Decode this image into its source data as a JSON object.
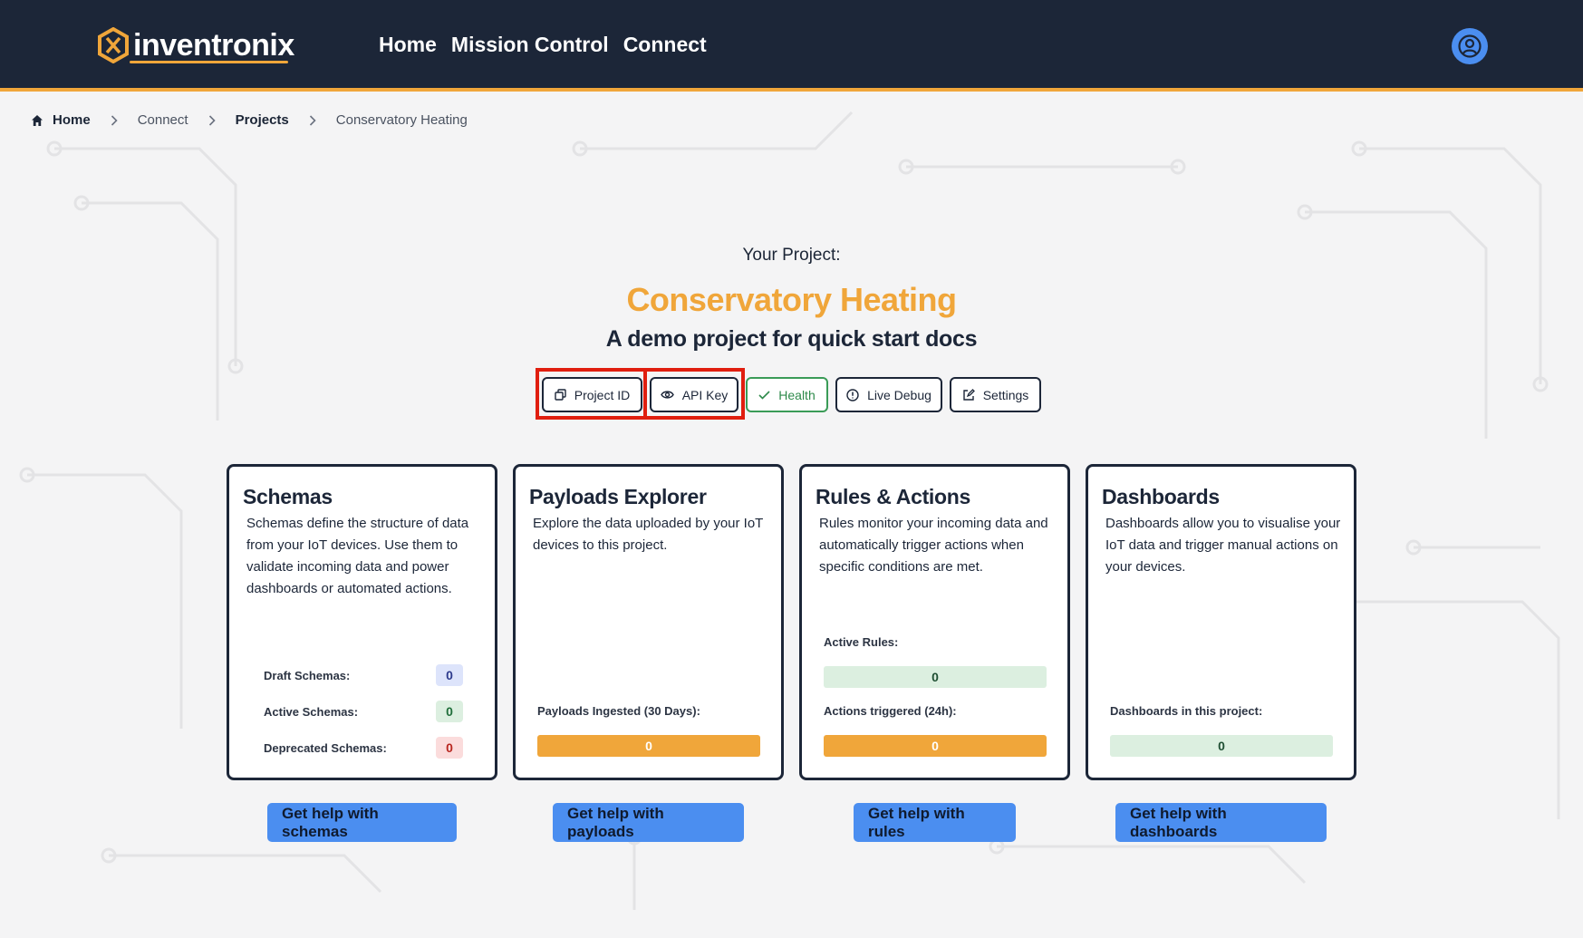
{
  "header": {
    "logo_text": "inventronix",
    "nav": [
      "Home",
      "Mission Control",
      "Connect"
    ],
    "brand_color": "#f0a63a",
    "header_bg": "#1c2638"
  },
  "breadcrumb": [
    "Home",
    "Connect",
    "Projects",
    "Conservatory Heating"
  ],
  "project": {
    "label": "Your Project:",
    "title": "Conservatory Heating",
    "description": "A demo project for quick start docs"
  },
  "actions": [
    {
      "label": "Project ID",
      "icon": "copy-icon"
    },
    {
      "label": "API Key",
      "icon": "eye-icon"
    },
    {
      "label": "Health",
      "icon": "check-icon"
    },
    {
      "label": "Live Debug",
      "icon": "info-icon"
    },
    {
      "label": "Settings",
      "icon": "edit-icon"
    }
  ],
  "cards": {
    "schemas": {
      "title": "Schemas",
      "text": "Schemas define the structure of data from your IoT devices. Use them to validate incoming data and power dashboards or automated actions.",
      "stats": [
        {
          "label": "Draft Schemas:",
          "value": "0"
        },
        {
          "label": "Active Schemas:",
          "value": "0"
        },
        {
          "label": "Deprecated Schemas:",
          "value": "0"
        }
      ]
    },
    "payloads": {
      "title": "Payloads Explorer",
      "text": "Explore the data uploaded by your IoT devices to this project.",
      "metric_label": "Payloads Ingested (30 Days):",
      "metric_value": "0"
    },
    "rules": {
      "title": "Rules & Actions",
      "text": "Rules monitor your incoming data and automatically trigger actions when specific conditions are met.",
      "active_label": "Active Rules:",
      "active_value": "0",
      "triggered_label": "Actions triggered (24h):",
      "triggered_value": "0"
    },
    "dashboards": {
      "title": "Dashboards",
      "text": "Dashboards allow you to visualise your IoT data and trigger manual actions on your devices.",
      "metric_label": "Dashboards in this project:",
      "metric_value": "0"
    }
  },
  "help_buttons": [
    "Get help with schemas",
    "Get help with payloads",
    "Get help with rules",
    "Get help with dashboards"
  ]
}
